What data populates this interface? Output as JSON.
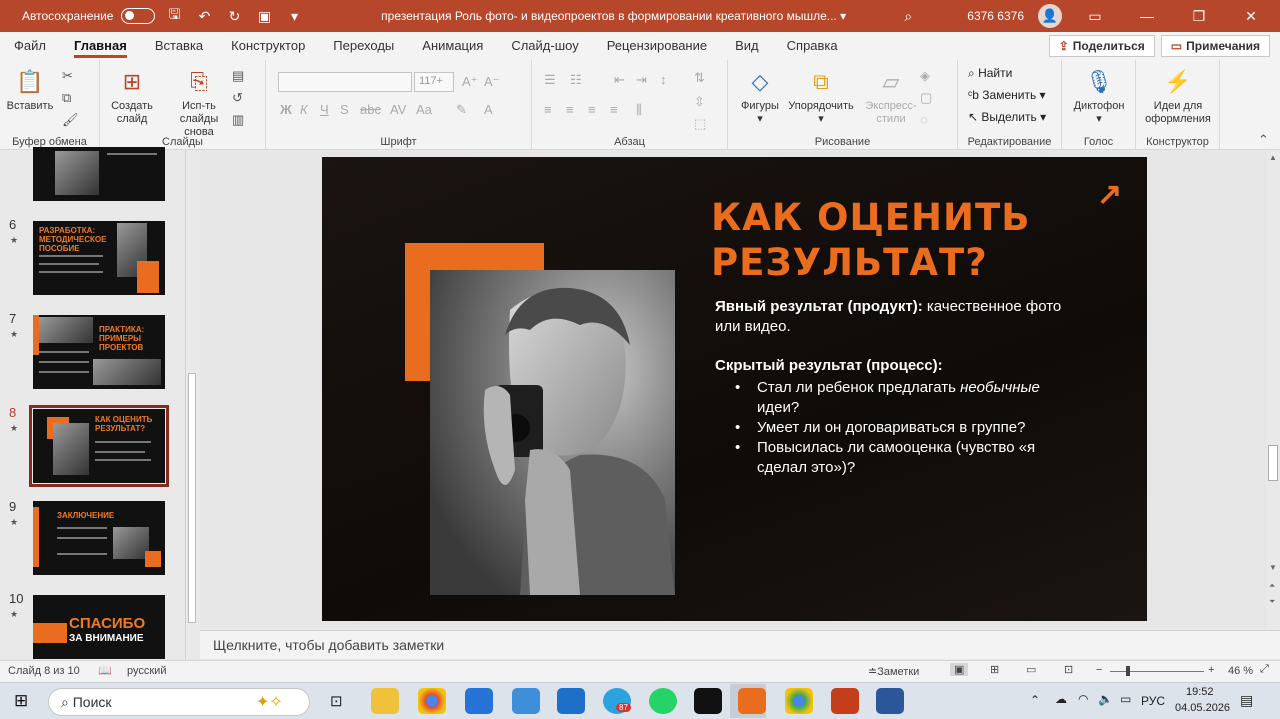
{
  "titlebar": {
    "autosave_label": "Автосохранение",
    "doc_title": "презентация Роль фото- и видеопроектов в формировании креативного мышле... ▾",
    "user_name": "6376 6376",
    "accent": "#b7472a"
  },
  "menu": {
    "tabs": [
      "Файл",
      "Главная",
      "Вставка",
      "Конструктор",
      "Переходы",
      "Анимация",
      "Слайд-шоу",
      "Рецензирование",
      "Вид",
      "Справка"
    ],
    "share_label": "Поделиться",
    "comments_label": "Примечания"
  },
  "ribbon": {
    "paste": "Вставить",
    "new_slide_1": "Создать",
    "new_slide_2": "слайд",
    "reuse_1": "Исп-ть",
    "reuse_2": "слайды снова",
    "font_size": "117+",
    "shapes": "Фигуры",
    "arrange": "Упорядочить",
    "quick_styles_1": "Экспресс-",
    "quick_styles_2": "стили",
    "find": "Найти",
    "replace": "Заменить",
    "select": "Выделить",
    "dictate": "Диктофон",
    "designer_1": "Идеи для",
    "designer_2": "оформления",
    "groups": {
      "clipboard": "Буфер обмена",
      "slides": "Слайды",
      "font": "Шрифт",
      "paragraph": "Абзац",
      "drawing": "Рисование",
      "editing": "Редактирование",
      "voice": "Голос",
      "designer": "Конструктор"
    }
  },
  "thumbnails": [
    {
      "num": "6",
      "title": "РАЗРАБОТКА: МЕТОДИЧЕСКОЕ ПОСОБИЕ"
    },
    {
      "num": "7",
      "title": "ПРАКТИКА: ПРИМЕРЫ ПРОЕКТОВ"
    },
    {
      "num": "8",
      "title": "КАК ОЦЕНИТЬ РЕЗУЛЬТАТ?"
    },
    {
      "num": "9",
      "title": "ЗАКЛЮЧЕНИЕ"
    },
    {
      "num": "10",
      "title": "СПАСИБО",
      "subtitle": "ЗА ВНИМАНИЕ"
    }
  ],
  "slide": {
    "title_line1": "КАК ОЦЕНИТЬ",
    "title_line2": "РЕЗУЛЬТАТ?",
    "explicit_label": "Явный результат (продукт):",
    "explicit_text": " качественное фото или видео.",
    "hidden_label": "Скрытый результат (процесс):",
    "bullet1_a": "Стал ли ребенок предлагать ",
    "bullet1_em": "необычные",
    "bullet1_b": " идеи?",
    "bullet2": "Умеет ли он договариваться в группе?",
    "bullet3": "Повысилась ли самооценка (чувство «я сделал это»)?",
    "orange": "#ea6d1f"
  },
  "notes_placeholder": "Щелкните, чтобы добавить заметки",
  "status": {
    "slide_info": "Слайд 8 из 10",
    "language": "русский",
    "notes_btn": "Заметки",
    "zoom": "46 %"
  },
  "taskbar": {
    "search": "Поиск",
    "lang": "РУС",
    "time": "19:52",
    "date": "04.05.2026",
    "telegram_badge": "87"
  }
}
